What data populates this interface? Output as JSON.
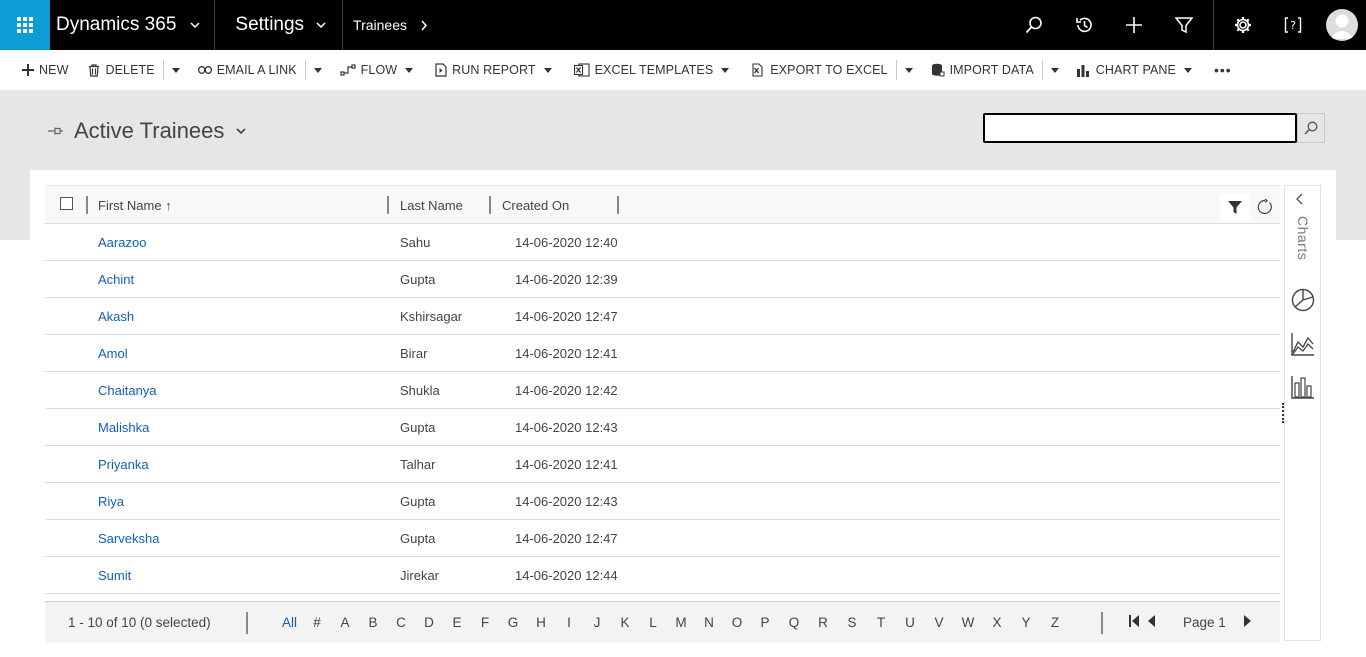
{
  "nav": {
    "app_name": "Dynamics 365",
    "area": "Settings",
    "entity": "Trainees"
  },
  "commands": {
    "new": "NEW",
    "delete": "DELETE",
    "email_link": "EMAIL A LINK",
    "flow": "FLOW",
    "run_report": "RUN REPORT",
    "excel_templates": "EXCEL TEMPLATES",
    "export_excel": "EXPORT TO EXCEL",
    "import_data": "IMPORT DATA",
    "chart_pane": "CHART PANE",
    "more": "•••"
  },
  "view": {
    "title": "Active Trainees",
    "search_value": "",
    "search_placeholder": ""
  },
  "grid": {
    "columns": [
      "First Name ↑",
      "Last Name",
      "Created On"
    ],
    "rows": [
      {
        "first": "Aarazoo",
        "last": "Sahu",
        "created": "14-06-2020 12:40"
      },
      {
        "first": "Achint",
        "last": "Gupta",
        "created": "14-06-2020 12:39"
      },
      {
        "first": "Akash",
        "last": "Kshirsagar",
        "created": "14-06-2020 12:47"
      },
      {
        "first": "Amol",
        "last": "Birar",
        "created": "14-06-2020 12:41"
      },
      {
        "first": "Chaitanya",
        "last": "Shukla",
        "created": "14-06-2020 12:42"
      },
      {
        "first": "Malishka",
        "last": "Gupta",
        "created": "14-06-2020 12:43"
      },
      {
        "first": "Priyanka",
        "last": "Talhar",
        "created": "14-06-2020 12:41"
      },
      {
        "first": "Riya",
        "last": "Gupta",
        "created": "14-06-2020 12:43"
      },
      {
        "first": "Sarveksha",
        "last": "Gupta",
        "created": "14-06-2020 12:47"
      },
      {
        "first": "Sumit",
        "last": "Jirekar",
        "created": "14-06-2020 12:44"
      }
    ]
  },
  "footer": {
    "count": "1 - 10 of 10 (0 selected)",
    "letters": [
      "All",
      "#",
      "A",
      "B",
      "C",
      "D",
      "E",
      "F",
      "G",
      "H",
      "I",
      "J",
      "K",
      "L",
      "M",
      "N",
      "O",
      "P",
      "Q",
      "R",
      "S",
      "T",
      "U",
      "V",
      "W",
      "X",
      "Y",
      "Z"
    ],
    "page": "Page 1"
  },
  "chart_pane": {
    "label": "Charts"
  },
  "colors": {
    "accent": "#0c9dd6",
    "link": "#1160b7",
    "topbar": "#000000",
    "band": "#e6e6e6"
  }
}
